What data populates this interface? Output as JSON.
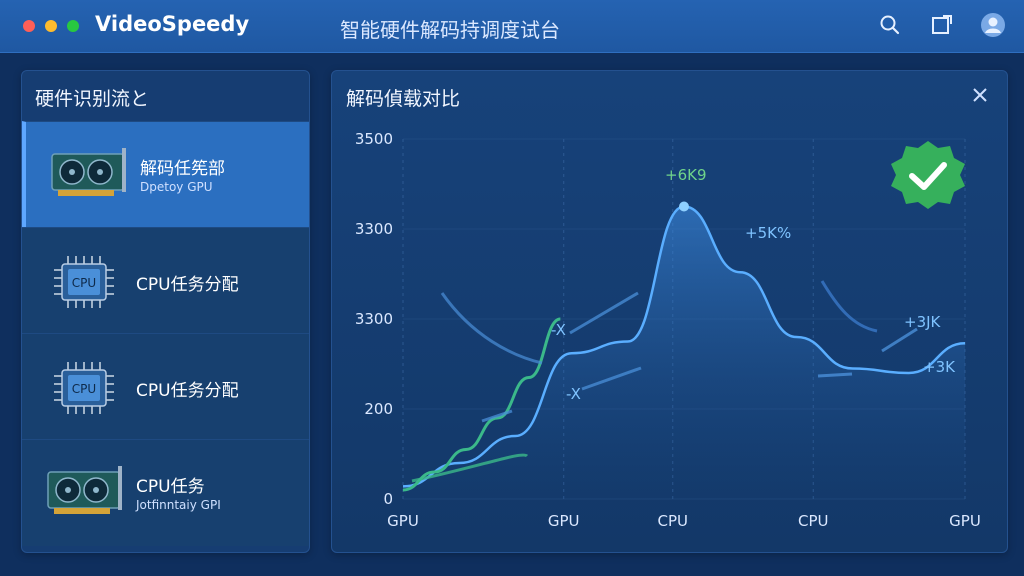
{
  "app": {
    "name": "VideoSpeedy",
    "window_title": "智能硬件解码持调度试台"
  },
  "icons": {
    "search": "search-icon",
    "expand": "expand-icon",
    "avatar": "user-avatar-icon",
    "close": "close-icon",
    "gpu": "gpu-card-icon",
    "cpu": "cpu-chip-icon",
    "check": "check-badge-icon"
  },
  "colors": {
    "accent": "#2b6fc0",
    "line": "#4aa3ff",
    "green": "#3bb96a"
  },
  "sidebar": {
    "title": "硬件识别流と",
    "items": [
      {
        "icon": "gpu",
        "label": "解码任筅部",
        "sub": "Dpetoy GPU",
        "selected": true
      },
      {
        "icon": "cpu",
        "label": "CPU任务分配",
        "sub": "",
        "selected": false
      },
      {
        "icon": "cpu",
        "label": "CPU任务分配",
        "sub": "",
        "selected": false
      },
      {
        "icon": "gpu",
        "label": "CPU任务",
        "sub": "Jotfinntaiy GPI",
        "selected": false
      }
    ]
  },
  "main": {
    "title": "解码偵载对比"
  },
  "chart_data": {
    "type": "area",
    "title": "",
    "x_tick_labels": [
      "GPU",
      "GPU",
      "CPU",
      "CPU",
      "GPU"
    ],
    "y_tick_labels": [
      "0",
      "200",
      "3300",
      "3300",
      "3500"
    ],
    "ylim": [
      0,
      400
    ],
    "grid": true,
    "series": [
      {
        "x": [
          0,
          0.1,
          0.2,
          0.3,
          0.4,
          0.5,
          0.6,
          0.7,
          0.8,
          0.9,
          1.0
        ],
        "values": [
          14,
          40,
          70,
          162,
          175,
          325,
          252,
          180,
          145,
          140,
          173
        ]
      },
      {
        "x": [
          0,
          0.1,
          0.2,
          0.3,
          0.4,
          0.5
        ],
        "values": [
          10,
          30,
          55,
          90,
          135,
          200
        ]
      }
    ],
    "annotations": [
      "+6K9",
      "+5K%",
      "-X",
      "+3JK",
      "+3K",
      "-X"
    ]
  }
}
